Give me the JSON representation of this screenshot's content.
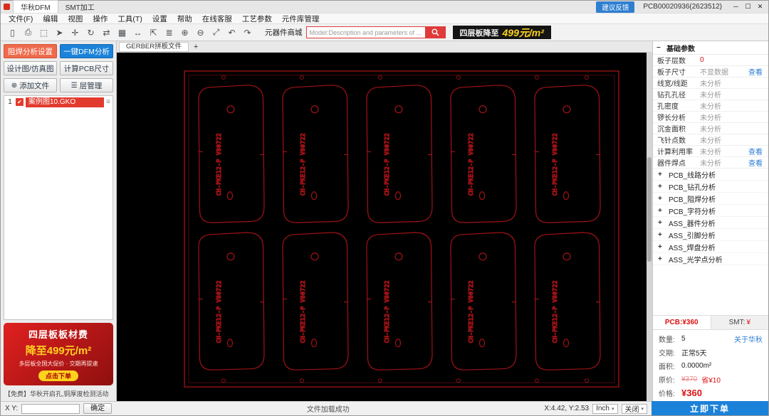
{
  "titlebar": {
    "tabs": [
      {
        "label": "华秋DFM"
      },
      {
        "label": "SMT加工"
      }
    ],
    "feedback_button": "建议反馈",
    "doc_title": "PCB00020936(2623512)",
    "window": {
      "minimize": "─",
      "maximize": "☐",
      "close": "✕"
    }
  },
  "menubar": {
    "items": [
      "文件(F)",
      "编辑",
      "视图",
      "操作",
      "工具(T)",
      "设置",
      "帮助",
      "在线客服",
      "工艺参数",
      "元件库管理"
    ]
  },
  "toolbar": {
    "icons": [
      {
        "name": "new-file-icon",
        "glyph": "▯"
      },
      {
        "name": "print-icon",
        "glyph": "⎙"
      },
      {
        "name": "select-area-icon",
        "glyph": "⬚"
      },
      {
        "name": "cursor-icon",
        "glyph": "➤"
      },
      {
        "name": "move-icon",
        "glyph": "✛"
      },
      {
        "name": "rotate-icon",
        "glyph": "↻"
      },
      {
        "name": "mirror-icon",
        "glyph": "⇄"
      },
      {
        "name": "panelize-icon",
        "glyph": "▦"
      },
      {
        "name": "measure-icon",
        "glyph": "↔"
      },
      {
        "name": "dimension-icon",
        "glyph": "⇱"
      },
      {
        "name": "layers-icon",
        "glyph": "≣"
      },
      {
        "name": "zoom-in-icon",
        "glyph": "⊕"
      },
      {
        "name": "zoom-out-icon",
        "glyph": "⊖"
      },
      {
        "name": "fit-view-icon",
        "glyph": "⤢"
      },
      {
        "name": "undo-icon",
        "glyph": "↶"
      },
      {
        "name": "redo-icon",
        "glyph": "↷"
      }
    ],
    "search_label": "元器件商城",
    "search_placeholder": "Model:Description and parameters of ...",
    "banner": {
      "prefix": "四层板降至",
      "price": "499元/m²"
    }
  },
  "canvas": {
    "tab": "GERBER拼板文件",
    "add_tab": "+",
    "board_label": "CH-PKE12-P V80722"
  },
  "left_panel": {
    "solder_mask_btn": "阻焊分析设置",
    "dfm_btn": "一键DFM分析",
    "design_btn": "设计图/仿真图",
    "size_btn": "计算PCB尺寸",
    "add_file_btn": "添加文件",
    "add_file_icon": "⊕",
    "layer_btn": "层管理",
    "layer_icon": "☰",
    "file_row": {
      "index": "1",
      "check": "✔",
      "name": "案例图10.GKO",
      "menu_icon": "≡"
    },
    "promo": {
      "line1": "四层板板材费",
      "line2": "降至499元/m²",
      "line3": "多层板全国大促价 · 交期再提速",
      "cta": "点击下单"
    },
    "notice": "【免费】华秋开启孔,铜厚度检测活动"
  },
  "params": {
    "collapse_icon": "−",
    "header": "基础参数",
    "rows": [
      {
        "label": "板子层数",
        "value": "0",
        "action": ""
      },
      {
        "label": "板子尺寸",
        "value": "不显数据",
        "action": "查看"
      },
      {
        "label": "线宽/线距",
        "value": "未分析",
        "action": ""
      },
      {
        "label": "钻孔孔径",
        "value": "未分析",
        "action": ""
      },
      {
        "label": "孔密度",
        "value": "未分析",
        "action": ""
      },
      {
        "label": "锣长分析",
        "value": "未分析",
        "action": ""
      },
      {
        "label": "沉金面积",
        "value": "未分析",
        "action": ""
      },
      {
        "label": "飞针点数",
        "value": "未分析",
        "action": ""
      },
      {
        "label": "计算利用率",
        "value": "未分析",
        "action": "查看"
      },
      {
        "label": "器件焊点",
        "value": "未分析",
        "action": "查看"
      }
    ],
    "groups": [
      {
        "icon": "+",
        "label": "PCB_线路分析"
      },
      {
        "icon": "+",
        "label": "PCB_钻孔分析"
      },
      {
        "icon": "+",
        "label": "PCB_阻焊分析"
      },
      {
        "icon": "+",
        "label": "PCB_字符分析"
      },
      {
        "icon": "+",
        "label": "ASS_器件分析"
      },
      {
        "icon": "+",
        "label": "ASS_引脚分析"
      },
      {
        "icon": "+",
        "label": "ASS_焊盘分析"
      },
      {
        "icon": "+",
        "label": "ASS_光学点分析"
      }
    ]
  },
  "order": {
    "tab_pcb": "PCB:¥360",
    "tab_smt_label": "SMT:",
    "tab_smt_value": "¥",
    "about_link": "关于华秋",
    "qty_label": "数量:",
    "qty_value": "5",
    "lead_label": "交期:",
    "lead_value": "正常5天",
    "area_label": "面积:",
    "area_value": "0.0000m²",
    "orig_label": "原价:",
    "orig_value": "¥370",
    "save_text": "省¥10",
    "price_label": "价格:",
    "price_value": "¥360",
    "order_btn": "立即下单"
  },
  "statusbar": {
    "xy_label": "X Y:",
    "confirm_btn": "确定",
    "message": "文件加载成功",
    "coords": "X:4.42, Y:2.53",
    "unit": "Inch",
    "mode": "关闭",
    "dropdown_icon": "▾"
  }
}
